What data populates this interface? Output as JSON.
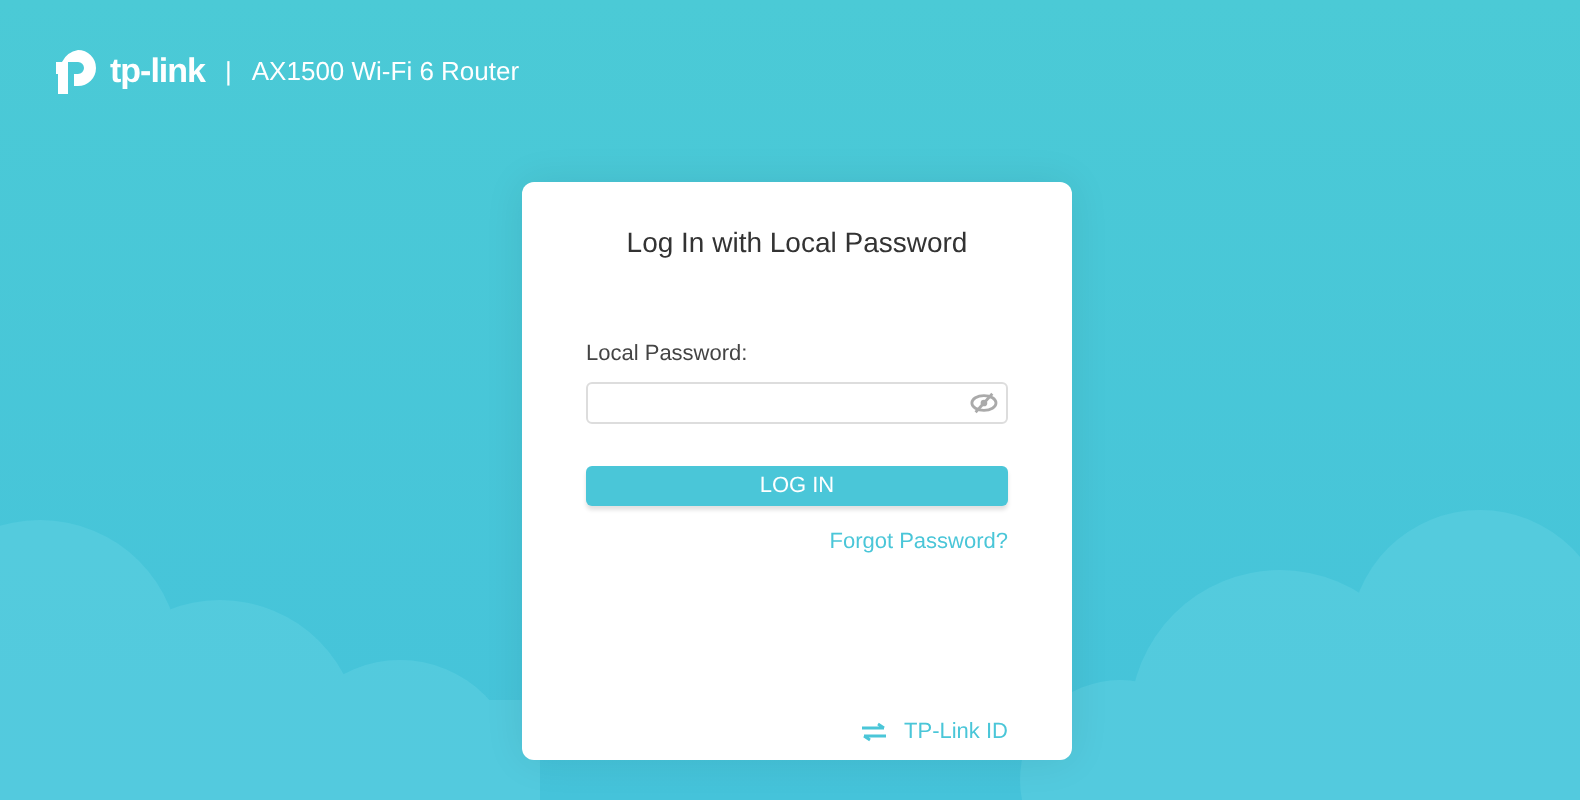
{
  "header": {
    "brand": "tp-link",
    "separator": "|",
    "product": "AX1500 Wi-Fi 6 Router"
  },
  "login": {
    "title": "Log In with Local Password",
    "password_label": "Local Password:",
    "button": "LOG IN",
    "forgot_link": "Forgot Password?",
    "id_link": "TP-Link ID"
  }
}
